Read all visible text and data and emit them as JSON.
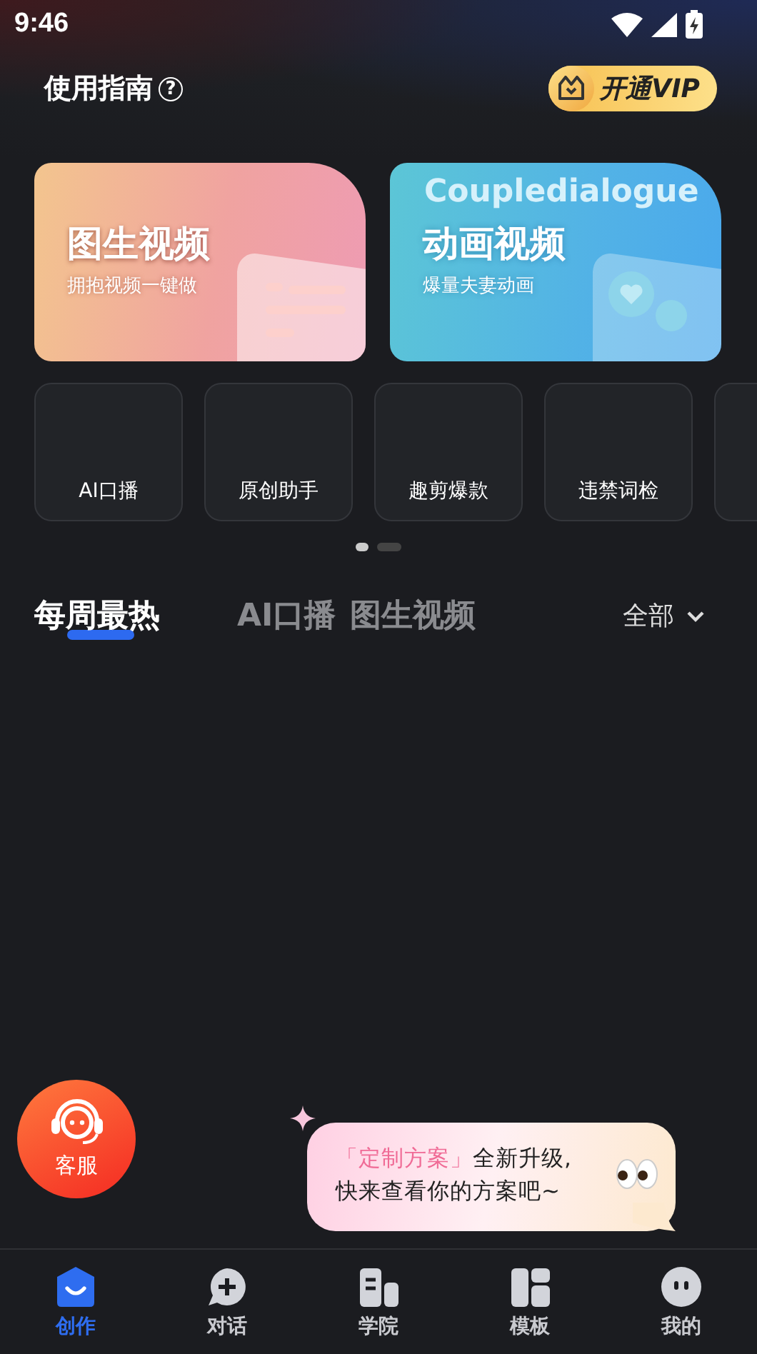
{
  "status_bar": {
    "time": "9:46"
  },
  "header": {
    "title": "使用指南",
    "help_icon": "?",
    "vip_button": "开通VIP"
  },
  "feature_cards": [
    {
      "kind": "image",
      "title": "图生视频",
      "subtitle": "拥抱视频一键做"
    },
    {
      "kind": "animation",
      "title": "动画视频",
      "subtitle": "爆量夫妻动画",
      "deco_text": "Coupledialogue"
    }
  ],
  "tools": [
    {
      "label": "AI口播"
    },
    {
      "label": "原创助手"
    },
    {
      "label": "趣剪爆款"
    },
    {
      "label": "违禁词检"
    },
    {
      "kind": "cut_off"
    }
  ],
  "pager": [
    {
      "selected": true
    },
    {
      "selected": false
    }
  ],
  "tabs": [
    {
      "label": "每周最热",
      "selected": true
    },
    {
      "label": "AI口播",
      "selected": false
    },
    {
      "label": "图生视频",
      "selected": false
    }
  ],
  "filter": {
    "label": "全部"
  },
  "service_button": {
    "label": "客服"
  },
  "promo_bubble": {
    "highlight": "「定制方案」",
    "line_1": "全新升级,",
    "line_2": "快来查看你的方案吧~"
  },
  "bottom_nav": [
    {
      "kind": "create",
      "label": "创作",
      "selected": true
    },
    {
      "kind": "chat",
      "label": "对话",
      "selected": false
    },
    {
      "kind": "academy",
      "label": "学院",
      "selected": false
    },
    {
      "kind": "template",
      "label": "模板",
      "selected": false
    },
    {
      "kind": "profile",
      "label": "我的",
      "selected": false
    }
  ]
}
